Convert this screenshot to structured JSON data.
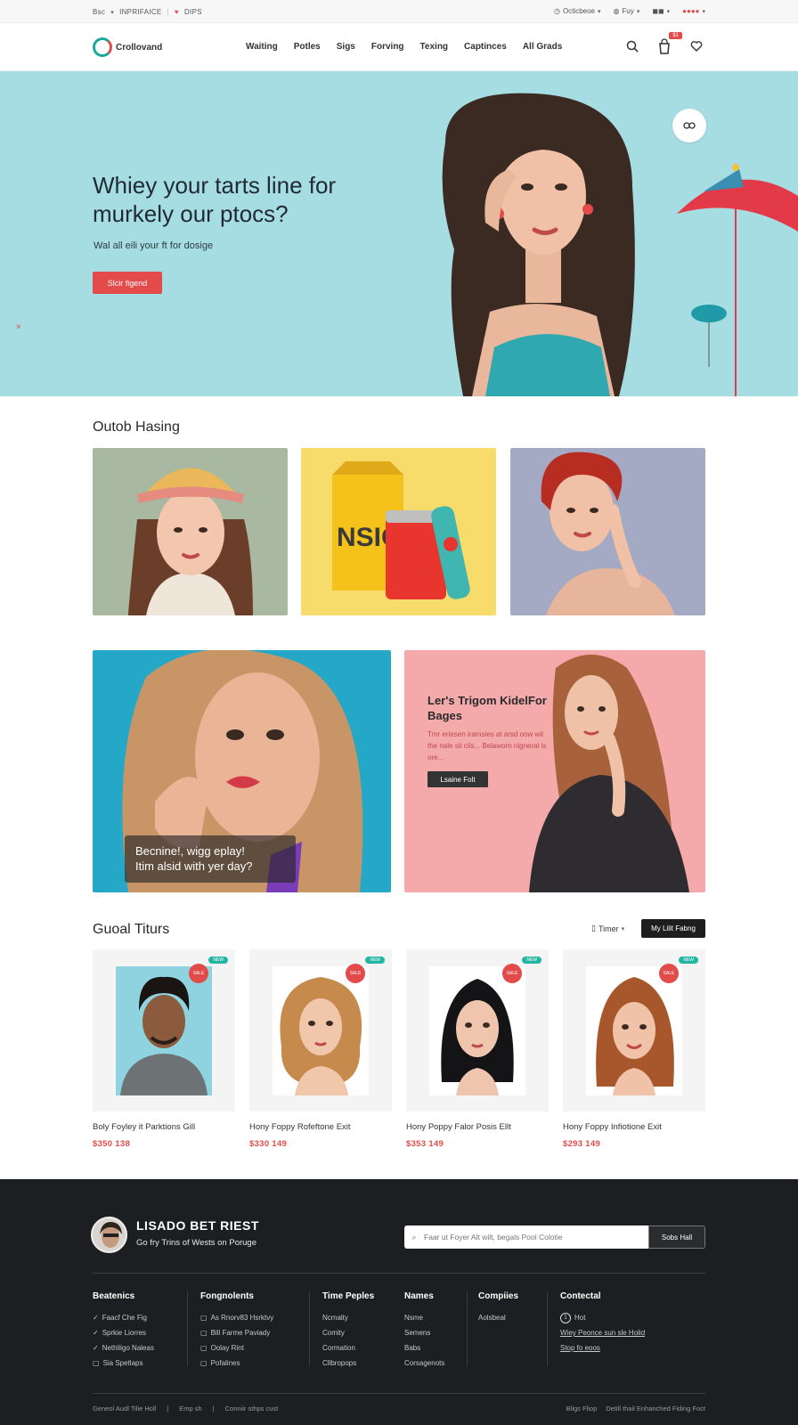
{
  "topbar": {
    "left_a": "Bsc",
    "left_b": "INPRIFAICE",
    "left_c": "DIPS",
    "currency": "Octicbeoe",
    "lang": "Fuy",
    "right_icons": "●●●●"
  },
  "header": {
    "logo": "Crollovand",
    "nav": [
      "Waiting",
      "Potles",
      "Sigs",
      "Forving",
      "Texing",
      "Captinces",
      "All Grads"
    ],
    "cart_badge": "$1"
  },
  "hero": {
    "title": "Whiey your tarts line for murkely our ptocs?",
    "subtitle": "Wal all eili your ft for dosige",
    "cta": "Slcir figend",
    "close_glyph": "×"
  },
  "categories": {
    "title": "Outob Hasing",
    "bag_text": "NSIO"
  },
  "promos": {
    "left_caption_l1": "Becnine!, wigg eplay!",
    "left_caption_l2": "Itim alsid with yer day?",
    "right_title": "Ler's Trigom KidelFor Bages",
    "right_text": "Tmr eriesen iramsies at arsd oow wit the nale sit cils... Belaworn nigneral is ore...",
    "right_btn": "Lsaine Folt"
  },
  "products": {
    "title": "Guoal Titurs",
    "sort_label": "Timer",
    "sort_btn": "My Lilit Fabng",
    "tag": "NEW",
    "sale": "SALE",
    "items": [
      {
        "name": "Boly Foyley it Parktions Gill",
        "price": "$350 138"
      },
      {
        "name": "Hony Foppy Rofeftone Exit",
        "price": "$330 149"
      },
      {
        "name": "Hony Poppy Falor Posis Ellt",
        "price": "$353 149"
      },
      {
        "name": "Hony Foppy Infiotione Exit",
        "price": "$293 149"
      }
    ]
  },
  "footer": {
    "heading": "LISADO BET RIEST",
    "sub": "Go fry Trins of Wests on Poruge",
    "search_placeholder": "Faar ut Foyer Alt wilt, begals Pool Colotie",
    "search_btn": "Sobs Hall",
    "columns": [
      {
        "title": "Beatenics",
        "items": [
          "Faacf Che Fig",
          "Sprkie Liorres",
          "Nethliigo Naleas",
          "Sia Spetlaps"
        ]
      },
      {
        "title": "Fongnolents",
        "items": [
          "As Rnorv83 Hsrktvy",
          "Bill Farme Paviady",
          "Oolay Rint",
          "Pofalines"
        ]
      },
      {
        "title": "Time Peples",
        "items": [
          "Ncmalty",
          "Comity",
          "Cormation",
          "Cllbropops"
        ]
      },
      {
        "title": "Names",
        "items": [
          "Nsme",
          "Semens",
          "Babs",
          "Corsagenots"
        ]
      },
      {
        "title": "Compiies",
        "items": [
          "Aolsbeal"
        ]
      },
      {
        "title": "Contectal",
        "items": [
          "Hot",
          "Wiey Peonce sun sle Holid",
          "Stop fo eoos"
        ]
      }
    ],
    "bottom_left": [
      "Geneol Audl Tilie Holl",
      "Emp sh",
      "Conniir sthps cust"
    ],
    "bottom_right": [
      "Bligs Fliop",
      "Detill thail Enhanched Fiding Foct"
    ]
  }
}
